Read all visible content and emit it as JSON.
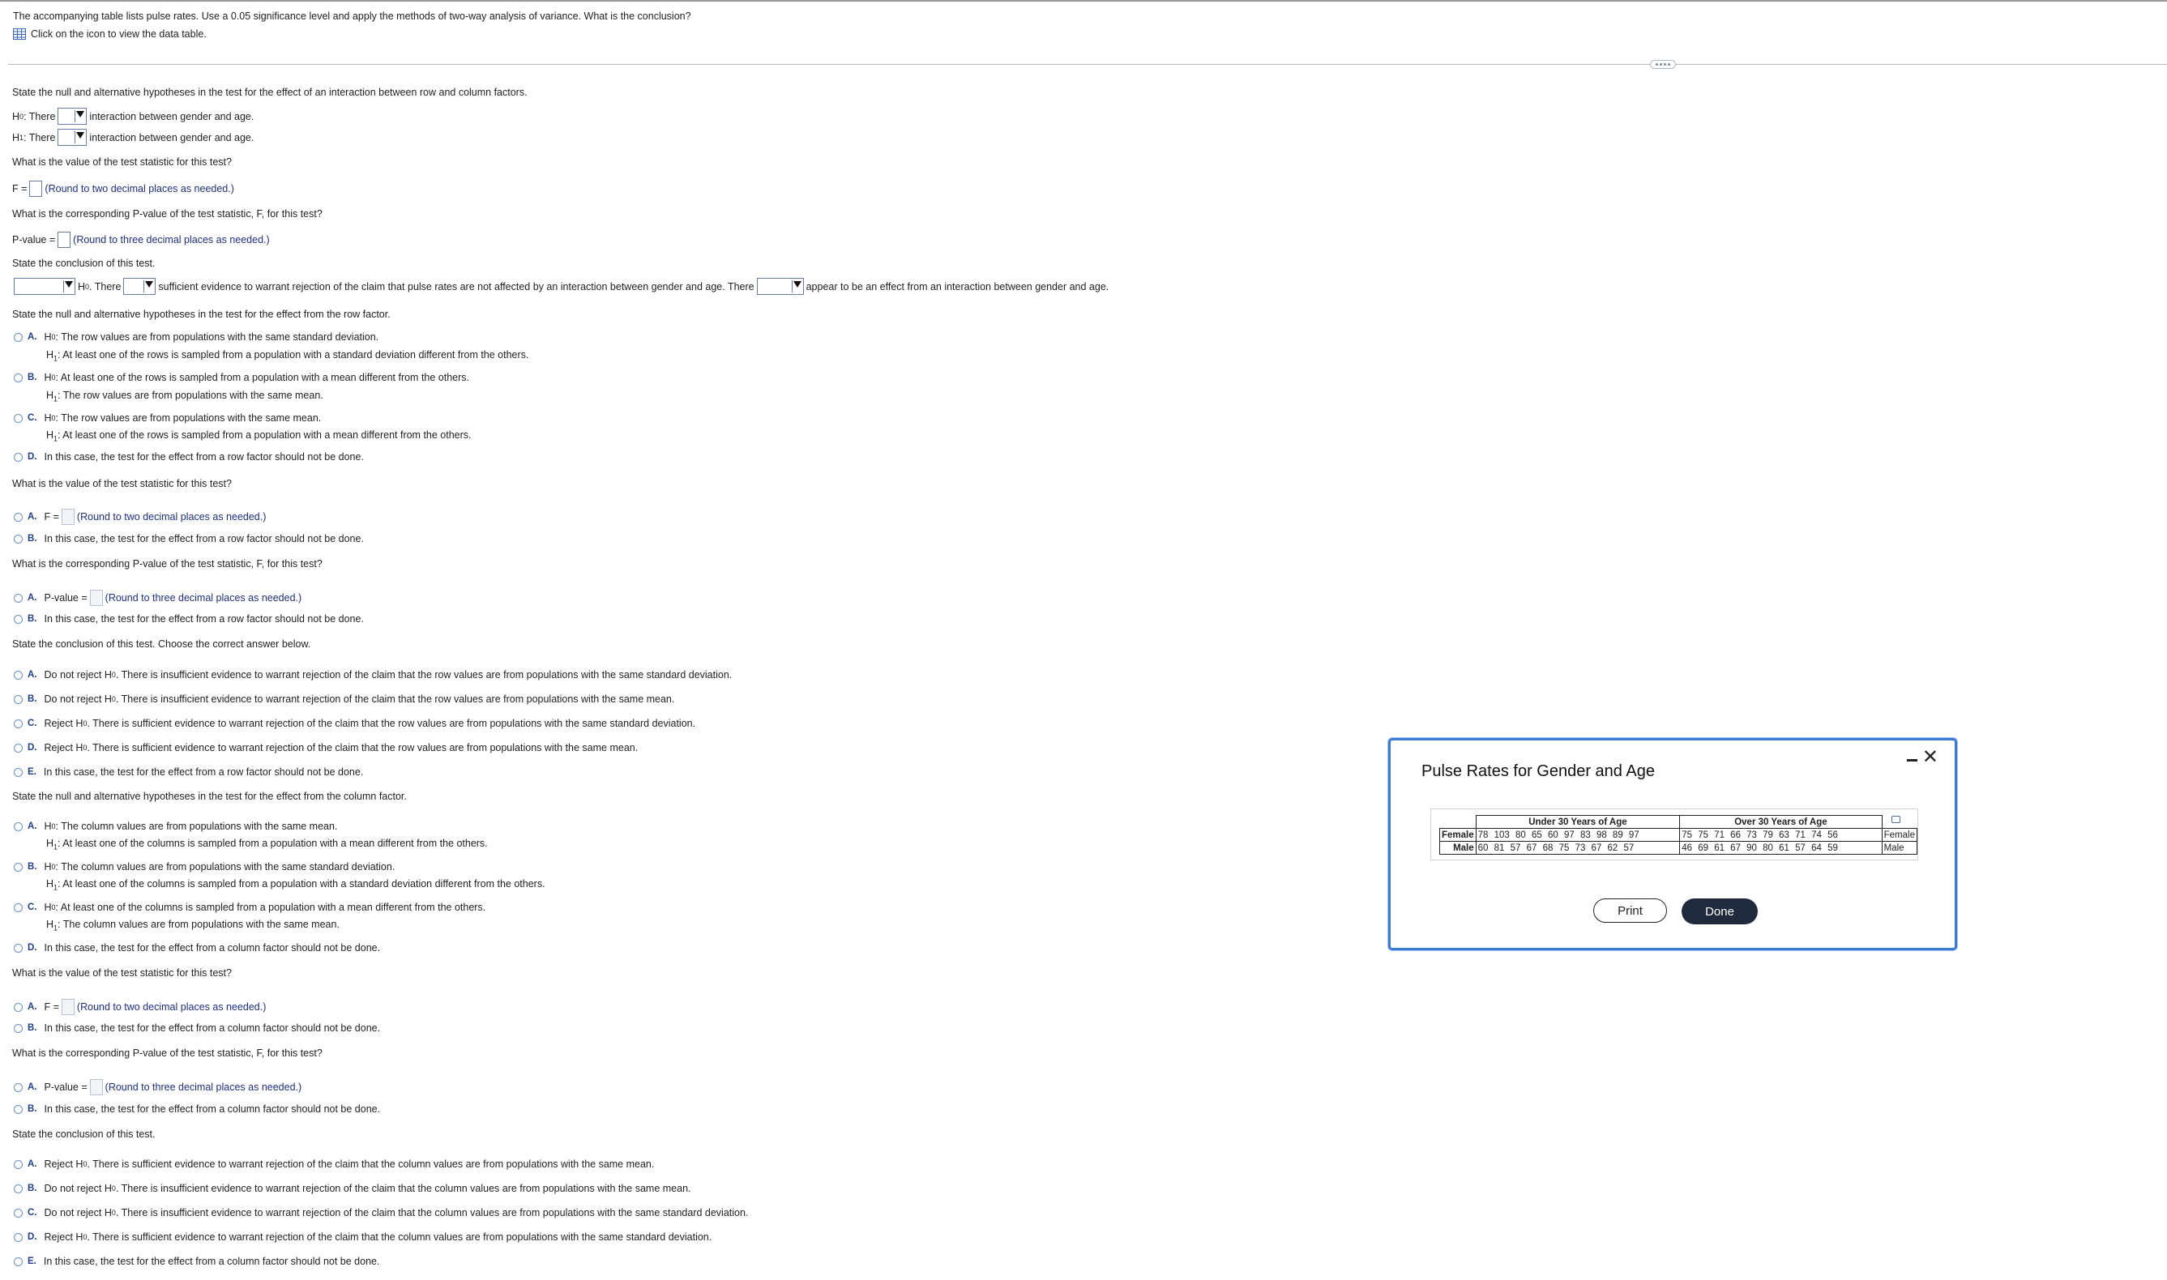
{
  "question": {
    "text": "The accompanying table lists pulse rates. Use a 0.05 significance level and apply the methods of two-way analysis of variance. What is the conclusion?",
    "view_table": "Click on the icon to view the data table."
  },
  "interaction": {
    "prompt": "State the null and alternative hypotheses in the test for the effect of an interaction between row and column factors.",
    "h0_prefix": "H",
    "h0_sub": "0",
    "h1_sub": "1",
    "there": ": There",
    "tail": "interaction between gender and age.",
    "f_question": "What is the value of the test statistic for this test?",
    "f_label": "F =",
    "f_note": "(Round to two decimal places as needed.)",
    "p_question": "What is the corresponding P-value of the test statistic, F, for this test?",
    "p_label": "P-value =",
    "p_note": "(Round to three decimal places as needed.)",
    "conclusion_prompt": "State the conclusion of this test.",
    "concl_h0": ". There",
    "concl_mid": "sufficient evidence to warrant rejection of the claim that pulse rates are not affected by an interaction between gender and age. There",
    "concl_tail": "appear to be an effect from an interaction between gender and age."
  },
  "row_factor": {
    "prompt": "State the null and alternative hypotheses in the test for the effect from the row factor.",
    "options": [
      {
        "letter": "A.",
        "h0": ": The row values are from populations with the same standard deviation.",
        "h1": ": At least one of the rows is sampled from a population with a standard deviation different from the others."
      },
      {
        "letter": "B.",
        "h0": ": At least one of the rows is sampled from a population with a mean different from the others.",
        "h1": ": The row values are from populations with the same mean."
      },
      {
        "letter": "C.",
        "h0": ": The row values are from populations with the same mean.",
        "h1": ": At least one of the rows is sampled from a population with a mean different from the others."
      },
      {
        "letter": "D.",
        "text": "In this case, the test for the effect from a row factor should not be done."
      }
    ],
    "f_question": "What is the value of the test statistic for this test?",
    "f_a": "A.",
    "f_label": "F =",
    "f_note": "(Round to two decimal places as needed.)",
    "f_b": "B.",
    "f_b_text": "In this case, the test for the effect from a row factor should not be done.",
    "p_question": "What is the corresponding P-value of the test statistic, F, for this test?",
    "p_a": "A.",
    "p_label": "P-value =",
    "p_note": "(Round to three decimal places as needed.)",
    "p_b": "B.",
    "p_b_text": "In this case, the test for the effect from a row factor should not be done.",
    "concl_prompt": "State the conclusion of this test. Choose the correct answer below.",
    "concl": [
      {
        "letter": "A.",
        "pre": "Do not reject H",
        "post": ". There is insufficient evidence to warrant rejection of the claim that the row values are from populations with the same standard deviation."
      },
      {
        "letter": "B.",
        "pre": "Do not reject H",
        "post": ". There is insufficient evidence to warrant rejection of the claim that the row values are from populations with the same mean."
      },
      {
        "letter": "C.",
        "pre": "Reject H",
        "post": ". There is sufficient evidence to warrant rejection of the claim that the row values are from populations with the same standard deviation."
      },
      {
        "letter": "D.",
        "pre": "Reject H",
        "post": ". There is sufficient evidence to warrant rejection of the claim that the row values are from populations with the same mean."
      },
      {
        "letter": "E.",
        "pre": "In this case, the test for the effect from a row factor should not be done.",
        "post": ""
      }
    ]
  },
  "column_factor": {
    "prompt": "State the null and alternative hypotheses in the test for the effect from the column factor.",
    "options": [
      {
        "letter": "A.",
        "h0": ": The column values are from populations with the same mean.",
        "h1": ": At least one of the columns is sampled from a population with a mean different from the others."
      },
      {
        "letter": "B.",
        "h0": ": The column values are from populations with the same standard deviation.",
        "h1": ": At least one of the columns is sampled from a population with a standard deviation different from the others."
      },
      {
        "letter": "C.",
        "h0": ": At least one of the columns is sampled from a population with a mean different from the others.",
        "h1": ": The column values are from populations with the same mean."
      },
      {
        "letter": "D.",
        "text": "In this case, the test for the effect from a column factor should not be done."
      }
    ],
    "f_question": "What is the value of the test statistic for this test?",
    "f_a": "A.",
    "f_label": "F =",
    "f_note": "(Round to two decimal places as needed.)",
    "f_b": "B.",
    "f_b_text": "In this case, the test for the effect from a column factor should not be done.",
    "p_question": "What is the corresponding P-value of the test statistic, F, for this test?",
    "p_a": "A.",
    "p_label": "P-value =",
    "p_note": "(Round to three decimal places as needed.)",
    "p_b": "B.",
    "p_b_text": "In this case, the test for the effect from a column factor should not be done.",
    "concl_prompt": "State the conclusion of this test.",
    "concl": [
      {
        "letter": "A.",
        "pre": "Reject H",
        "post": ". There is sufficient evidence to warrant rejection of the claim that the column values are from populations with the same mean."
      },
      {
        "letter": "B.",
        "pre": "Do not reject H",
        "post": ". There is insufficient evidence to warrant rejection of the claim that the column values are from populations with the same mean."
      },
      {
        "letter": "C.",
        "pre": "Do not reject H",
        "post": ". There is insufficient evidence to warrant rejection of the claim that the column values are from populations with the same standard deviation."
      },
      {
        "letter": "D.",
        "pre": "Reject H",
        "post": ". There is sufficient evidence to warrant rejection of the claim that the column values are from populations with the same standard deviation."
      },
      {
        "letter": "E.",
        "pre": "In this case, the test for the effect from a column factor should not be done.",
        "post": ""
      }
    ]
  },
  "modal": {
    "title": "Pulse Rates for Gender and Age",
    "col1": "Under 30 Years of Age",
    "col2": "Over 30 Years of Age",
    "female_label": "Female",
    "male_label": "Male",
    "female_under": "78 103 80 65 60 97 83 98 89 97",
    "female_over": "75 75 71 66 73 79 63 71 74 56",
    "male_under": "60 81 57 67 68 75 73 67 62 57",
    "male_over": "46 69 61 67 90 80 61 57 64 59",
    "print": "Print",
    "done": "Done"
  }
}
